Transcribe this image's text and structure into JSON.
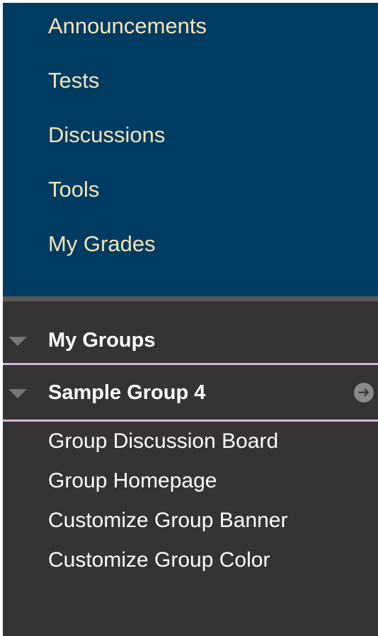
{
  "course_menu": {
    "items": [
      {
        "label": "Announcements"
      },
      {
        "label": "Tests"
      },
      {
        "label": "Discussions"
      },
      {
        "label": "Tools"
      },
      {
        "label": "My Grades"
      }
    ]
  },
  "groups": {
    "section_label": "My Groups",
    "group": {
      "name": "Sample Group 4",
      "go_icon": "arrow-right-circle-icon",
      "tools": [
        {
          "label": "Group Discussion Board"
        },
        {
          "label": "Group Homepage"
        },
        {
          "label": "Customize Group Banner"
        },
        {
          "label": "Customize Group Color"
        }
      ]
    }
  },
  "colors": {
    "course_menu_bg": "#003b62",
    "course_menu_text": "#f4e5b8",
    "groups_bg": "#353334",
    "accent_line": "#d8b4de"
  }
}
